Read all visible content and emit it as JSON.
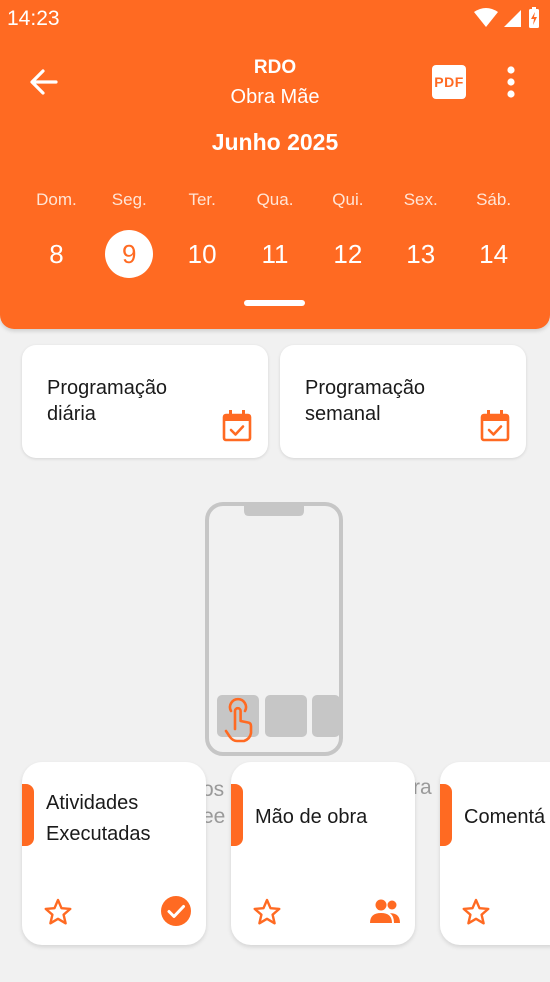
{
  "status_bar": {
    "time": "14:23"
  },
  "header": {
    "title": "RDO",
    "subtitle": "Obra Mãe",
    "pdf_label": "PDF",
    "month": "Junho 2025"
  },
  "week": [
    {
      "name": "Dom.",
      "num": "8"
    },
    {
      "name": "Seg.",
      "num": "9",
      "selected": true
    },
    {
      "name": "Ter.",
      "num": "10"
    },
    {
      "name": "Qua.",
      "num": "11"
    },
    {
      "name": "Qui.",
      "num": "12"
    },
    {
      "name": "Sex.",
      "num": "13"
    },
    {
      "name": "Sáb.",
      "num": "14"
    }
  ],
  "programacao": [
    {
      "label": "Programação\ndiária"
    },
    {
      "label": "Programação\nsemanal"
    }
  ],
  "background_text": {
    "left": "os\nee",
    "right": "ra"
  },
  "activities": [
    {
      "label": "Atividades\nExecutadas",
      "icon": "check-circle-icon"
    },
    {
      "label": "Mão de obra",
      "icon": "people-icon"
    },
    {
      "label": "Comentá"
    }
  ],
  "colors": {
    "accent": "#ff6a22",
    "background": "#f1f1f1"
  }
}
